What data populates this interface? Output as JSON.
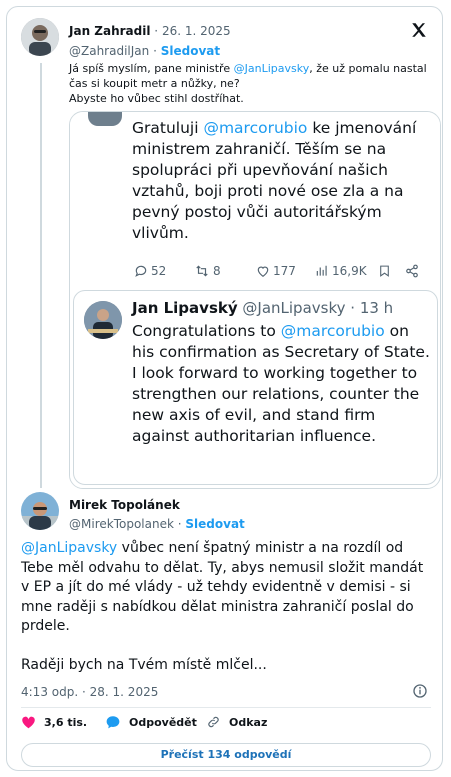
{
  "quote": {
    "author": "Jan Zahradil",
    "separator": "·",
    "date": "26. 1. 2025",
    "handle": "@ZahradilJan",
    "follow": "Sledovat",
    "text_prefix": "Já spíš myslím, pane ministře ",
    "text_mention": "@JanLipavsky",
    "text_suffix": ", že už pomalu nastal čas si koupit metr a nůžky, ne?",
    "text_line2": "Abyste ho vůbec stihl dostříhat."
  },
  "screenshot": {
    "cz_prefix": "Gratuluji ",
    "cz_mention": "@marcorubio",
    "cz_suffix": " ke jmenování ministrem zahraničí. Těším se na spolupráci při upevňování našich vztahů, boji proti nové ose zla a na pevný postoj vůči autoritářským vlivům.",
    "stats": {
      "replies": "52",
      "reposts": "8",
      "likes": "177",
      "views": "16,9K"
    },
    "inner": {
      "author": "Jan Lipavský",
      "handle": "@JanLipavsky",
      "time": "· 13 h",
      "text_prefix": "Congratulations to ",
      "text_mention": "@marcorubio",
      "text_suffix": " on his confirmation as Secretary of State. I look forward to working together to strengthen our relations, counter the new axis of evil, and stand firm against authoritarian influence."
    }
  },
  "main": {
    "author": "Mirek Topolánek",
    "handle": "@MirekTopolanek",
    "separator": "·",
    "follow": "Sledovat",
    "text_mention": "@JanLipavsky",
    "text_body": " vůbec není špatný ministr a na rozdíl od Tebe měl odvahu to dělat. Ty, abys nemusil složit mandát v EP a jít do mé vlády - už tehdy evidentně v demisi - si mne raději s nabídkou dělat ministra zahraničí poslal do prdele.",
    "text_last": "Raději bych na Tvém místě mlčel...",
    "time": "4:13 odp.",
    "date": "28. 1. 2025",
    "likes": "3,6 tis.",
    "reply": "Odpovědět",
    "copy": "Odkaz",
    "read_more": "Přečíst 134 odpovědí"
  },
  "colors": {
    "accent": "#1d9bf0",
    "like": "#f91880",
    "muted": "#536471",
    "border": "#cfd9de"
  }
}
